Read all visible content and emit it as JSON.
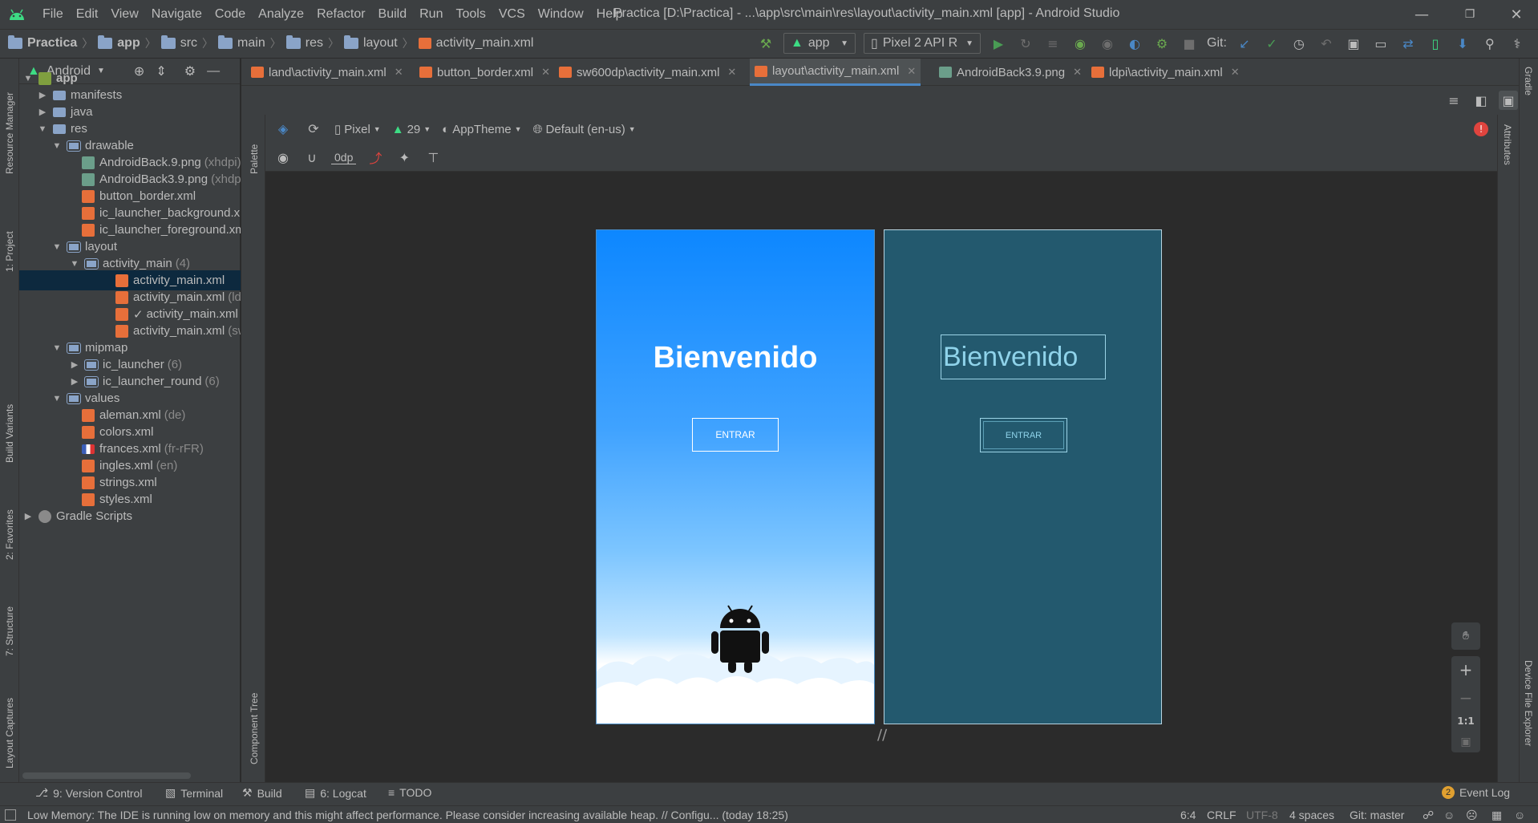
{
  "window": {
    "title": "Practica [D:\\Practica] - ...\\app\\src\\main\\res\\layout\\activity_main.xml [app] - Android Studio",
    "menu": [
      "File",
      "Edit",
      "View",
      "Navigate",
      "Code",
      "Analyze",
      "Refactor",
      "Build",
      "Run",
      "Tools",
      "VCS",
      "Window",
      "Help"
    ]
  },
  "breadcrumb": [
    "Practica",
    "app",
    "src",
    "main",
    "res",
    "layout",
    "activity_main.xml"
  ],
  "toolbar": {
    "run_config": "app",
    "device": "Pixel 2 API R",
    "git_label": "Git:"
  },
  "project_panel": {
    "view_mode": "Android",
    "tree": [
      {
        "label": "app",
        "muted": ""
      },
      {
        "label": "manifests",
        "muted": ""
      },
      {
        "label": "java",
        "muted": ""
      },
      {
        "label": "res",
        "muted": ""
      },
      {
        "label": "drawable",
        "muted": ""
      },
      {
        "label": "AndroidBack.9.png",
        "muted": "(xhdpi)"
      },
      {
        "label": "AndroidBack3.9.png",
        "muted": "(xhdpi)"
      },
      {
        "label": "button_border.xml",
        "muted": ""
      },
      {
        "label": "ic_launcher_background.xml",
        "muted": ""
      },
      {
        "label": "ic_launcher_foreground.xml",
        "muted": ""
      },
      {
        "label": "layout",
        "muted": ""
      },
      {
        "label": "activity_main",
        "muted": "(4)"
      },
      {
        "label": "activity_main.xml",
        "muted": ""
      },
      {
        "label": "activity_main.xml",
        "muted": "(ldpi)"
      },
      {
        "label": "activity_main.xml",
        "muted": ""
      },
      {
        "label": "activity_main.xml",
        "muted": "(sw600dp)"
      },
      {
        "label": "mipmap",
        "muted": ""
      },
      {
        "label": "ic_launcher",
        "muted": "(6)"
      },
      {
        "label": "ic_launcher_round",
        "muted": "(6)"
      },
      {
        "label": "values",
        "muted": ""
      },
      {
        "label": "aleman.xml",
        "muted": "(de)"
      },
      {
        "label": "colors.xml",
        "muted": ""
      },
      {
        "label": "frances.xml",
        "muted": "(fr-rFR)"
      },
      {
        "label": "ingles.xml",
        "muted": "(en)"
      },
      {
        "label": "strings.xml",
        "muted": ""
      },
      {
        "label": "styles.xml",
        "muted": ""
      },
      {
        "label": "Gradle Scripts",
        "muted": ""
      }
    ]
  },
  "editor_tabs": [
    "land\\activity_main.xml",
    "button_border.xml",
    "sw600dp\\activity_main.xml",
    "layout\\activity_main.xml",
    "AndroidBack3.9.png",
    "ldpi\\activity_main.xml"
  ],
  "design_toolbar": {
    "device": "Pixel",
    "api": "29",
    "theme": "AppTheme",
    "locale": "Default (en-us)",
    "margin": "0dp"
  },
  "preview": {
    "title_text": "Bienvenido",
    "button_text": "ENTRAR"
  },
  "left_tools": [
    "Resource Manager",
    "1: Project",
    "Build Variants",
    "2: Favorites",
    "7: Structure",
    "Layout Captures"
  ],
  "right_tools": [
    "Gradle",
    "Attributes",
    "Device File Explorer"
  ],
  "side_labels": {
    "palette": "Palette",
    "component_tree": "Component Tree"
  },
  "zoom": {
    "one_to_one": "1:1"
  },
  "bottom_tabs": [
    "9: Version Control",
    "Terminal",
    "Build",
    "6: Logcat",
    "TODO"
  ],
  "event_log": {
    "count": "2",
    "label": "Event Log"
  },
  "status": {
    "message": "Low Memory: The IDE is running low on memory and this might affect performance. Please consider increasing available heap. // Configu... (today 18:25)",
    "position": "6:4",
    "line_sep": "CRLF",
    "encoding": "UTF-8",
    "indent": "4 spaces",
    "git": "Git: master"
  },
  "colors": {
    "accent": "#4a88c7",
    "design_top": "#0d87ff",
    "blueprint": "#23596e",
    "android_green": "#3ddc84",
    "error_red": "#e0443e"
  }
}
